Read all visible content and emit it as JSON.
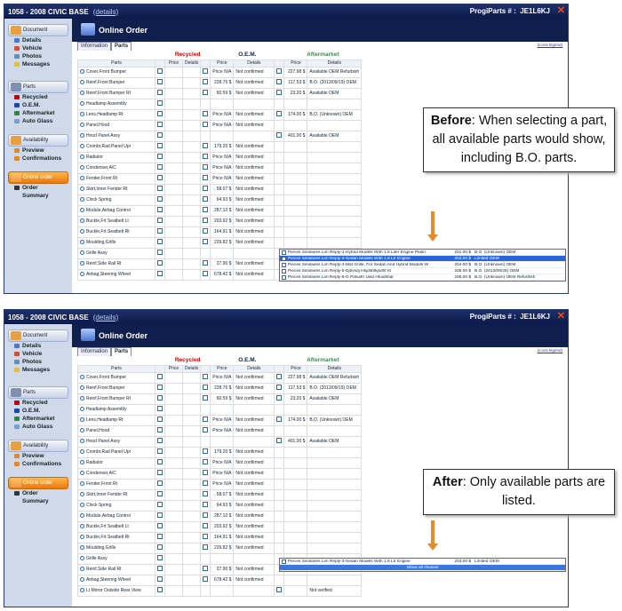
{
  "colors": {
    "title": "#0f1f4e",
    "accent": "#e58a2e",
    "recycled": "#c00000",
    "aftermarket": "#448855"
  },
  "window": {
    "title": "1058 - 2008 CIVIC BASE",
    "details_link": "(details)",
    "app_label": "ProgiParts # :",
    "code": "JE1L6KJ",
    "close_icon": "close-icon"
  },
  "header": {
    "title": "Online Order"
  },
  "tabs": [
    "Information",
    "Parts"
  ],
  "icons_legend_link": "(icons legend)",
  "sidebar": {
    "document": {
      "title": "Document",
      "items": [
        "Details",
        "Vehicle",
        "Photos",
        "Messages"
      ]
    },
    "parts": {
      "title": "Parts",
      "items": [
        "Recycled",
        "O.E.M.",
        "Aftermarket",
        "Auto Glass"
      ]
    },
    "availability": {
      "title": "Availability",
      "items": [
        "Preview",
        "Confirmations"
      ]
    },
    "online": {
      "title": "Online order",
      "items": [
        "Order",
        "Summary"
      ]
    }
  },
  "groups": {
    "recycled": "Recycled",
    "oem": "O.E.M.",
    "aftermarket": "Aftermarket"
  },
  "columns": {
    "parts": "Parts",
    "price": "Price",
    "details": "Details"
  },
  "rows": [
    {
      "part": "Cover,Front Bumper",
      "op": "Price N/A",
      "od": "Not confirmed",
      "ap": "227.98 $",
      "ad": "Available OEM Refurbish"
    },
    {
      "part": "Reinf,Front Bumper",
      "op": "228.76 $",
      "od": "Not confirmed",
      "ap": "117.53 $",
      "ad": "B.O. (2013/09/19) OEM"
    },
    {
      "part": "Reinf,Front Bumper    Rt",
      "op": "60.59 $",
      "od": "Not confirmed",
      "ap": "23.20 $",
      "ad": "Available OEM"
    },
    {
      "part": "Headlamp Assembly",
      "op": "",
      "od": "",
      "ap": "",
      "ad": ""
    },
    {
      "part": "Lens,Headlamp    Rt",
      "op": "Price N/A",
      "od": "Not confirmed",
      "ap": "174.00 $",
      "ad": "B.O. (Unknown) OEM"
    },
    {
      "part": "Panel,Hood",
      "op": "Price N/A",
      "od": "Not confirmed",
      "ap": "",
      "ad": ""
    },
    {
      "part": "Hood Panel Assy",
      "op": "",
      "od": "",
      "ap": "401.00 $",
      "ad": "Available OEM"
    },
    {
      "part": "Crsmbr,Rad Panel Upr",
      "op": "179.20 $",
      "od": "Not confirmed",
      "ap": "",
      "ad": ""
    },
    {
      "part": "Radiator",
      "op": "Price N/A",
      "od": "Not confirmed",
      "ap": "",
      "ad": ""
    },
    {
      "part": "Condenser,A/C",
      "op": "Price N/A",
      "od": "Not confirmed",
      "ap": "",
      "ad": ""
    },
    {
      "part": "Fender,Front    Rt",
      "op": "Price N/A",
      "od": "Not confirmed",
      "ap": "",
      "ad": ""
    },
    {
      "part": "Skirt,Inner Fender    Rt",
      "op": "58.07 $",
      "od": "Not confirmed",
      "ap": "",
      "ad": ""
    },
    {
      "part": "Clock Spring",
      "op": "64.93 $",
      "od": "Not confirmed",
      "ap": "",
      "ad": ""
    },
    {
      "part": "Module,Airbag Control",
      "op": "287.10 $",
      "od": "Not confirmed",
      "ap": "",
      "ad": ""
    },
    {
      "part": "Buckle,Frt Seatbelt    Lt",
      "op": "203.92 $",
      "od": "Not confirmed",
      "ap": "",
      "ad": ""
    },
    {
      "part": "Buckle,Frt Seatbelt    Rt",
      "op": "164.91 $",
      "od": "Not confirmed",
      "ap": "",
      "ad": ""
    },
    {
      "part": "Moulding,Grille",
      "op": "229.82 $",
      "od": "Not confirmed",
      "ap": "",
      "ad": ""
    },
    {
      "part": "Grille Assy",
      "op": "",
      "od": "",
      "ap": "",
      "ad": ""
    },
    {
      "part": "Reinf,Side Rail    Rt",
      "op": "27.90 $",
      "od": "Not confirmed",
      "ap": "",
      "ad": ""
    },
    {
      "part": "Airbag,Steering Wheel",
      "op": "678.42 $",
      "od": "Not confirmed",
      "ap": "",
      "ad": ""
    },
    {
      "part": "Lt Mirror Outside Rear View",
      "op": "",
      "od": "",
      "ap": "",
      "ad": "Not verified"
    }
  ],
  "dropdown_before": [
    {
      "text": "Pieces Similaires Lim  Reply-1-Hybrid Models With 1.8 Liter Engine Platin",
      "price": "201.00 $",
      "detail": "B.O. (Unknown) OEM",
      "selected": false
    },
    {
      "text": "Pieces Similaires Lim  Reply-3-Sedan Models With 1.8 Ltr Engine",
      "price": "203.00 $",
      "detail": "Limited OEM",
      "selected": true
    },
    {
      "text": "Pieces Similaires Lim  Reply-4-Mat Grille, For Sedan And Hybrid Models W",
      "price": "204.00 $",
      "detail": "B.O. (Unknown) OEM",
      "selected": false
    },
    {
      "text": "Pieces Similaires Lim  Reply-5-Djbvsdj Hkjdsbfkjsdhf Kl",
      "price": "205.00 $",
      "detail": "B.O. (2013/09/25) OEM",
      "selected": false
    },
    {
      "text": "Pieces Similaires Lim  Reply-6-G Pdsuifh Uisd Hfuidshaf",
      "price": "206.00 $",
      "detail": "B.O. (Unknown) OEM Refurbish",
      "selected": false
    }
  ],
  "dropdown_after": [
    {
      "text": "Pieces Similaires Lim  Reply-3-Sedan Models With 1.8 Ltr Engine",
      "price": "203.00 $",
      "detail": "Limited OEM"
    }
  ],
  "show_all": "Show all choices",
  "callouts": {
    "before": {
      "label": "Before",
      "text": ": When selecting a part, all available parts would show, including B.O. parts."
    },
    "after": {
      "label": "After",
      "text": ": Only available parts are listed."
    }
  }
}
